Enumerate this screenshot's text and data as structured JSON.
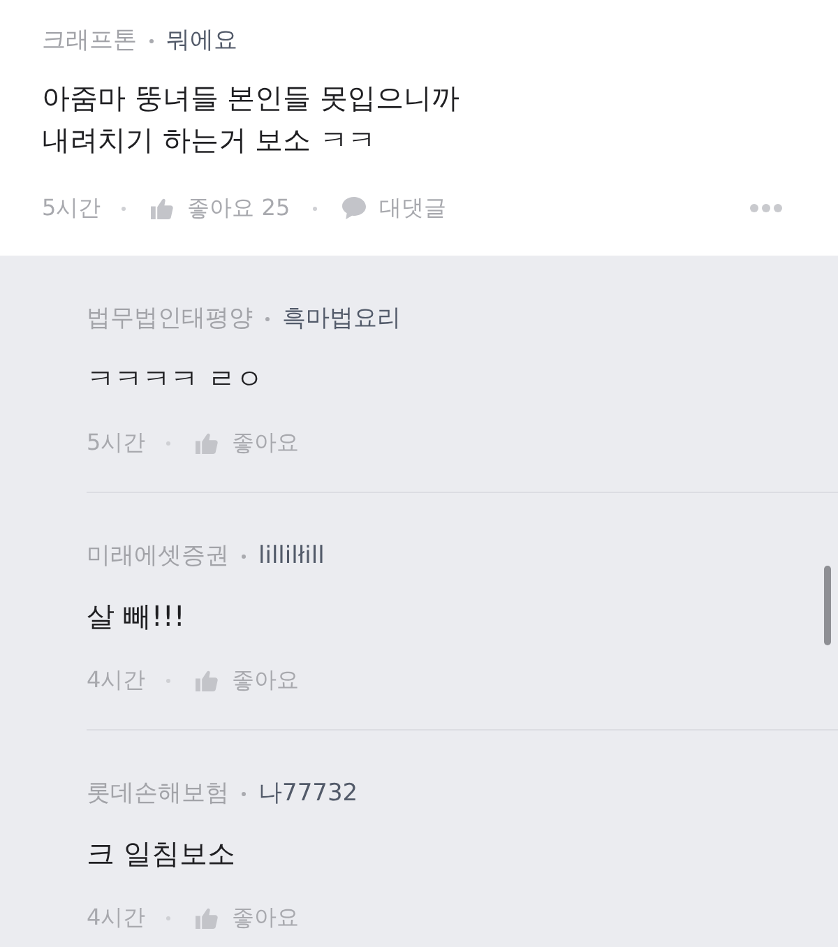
{
  "comment": {
    "affiliation": "크래프톤",
    "nickname": "뭐에요",
    "text": "아줌마 뚱녀들 본인들 못입으니까\n내려치기 하는거 보소 ㅋㅋ",
    "time": "5시간",
    "like_label": "좋아요 25",
    "reply_label": "대댓글"
  },
  "replies": [
    {
      "affiliation": "법무법인태평양",
      "nickname": "흑마법요리",
      "text": "ㅋㅋㅋㅋ ㄹㅇ",
      "time": "5시간",
      "like_label": "좋아요"
    },
    {
      "affiliation": "미래에셋증권",
      "nickname": "lillilłill",
      "text": "살 빼!!!",
      "time": "4시간",
      "like_label": "좋아요"
    },
    {
      "affiliation": "롯데손해보험",
      "nickname": "나77732",
      "text": "크 일침보소",
      "time": "4시간",
      "like_label": "좋아요"
    }
  ]
}
